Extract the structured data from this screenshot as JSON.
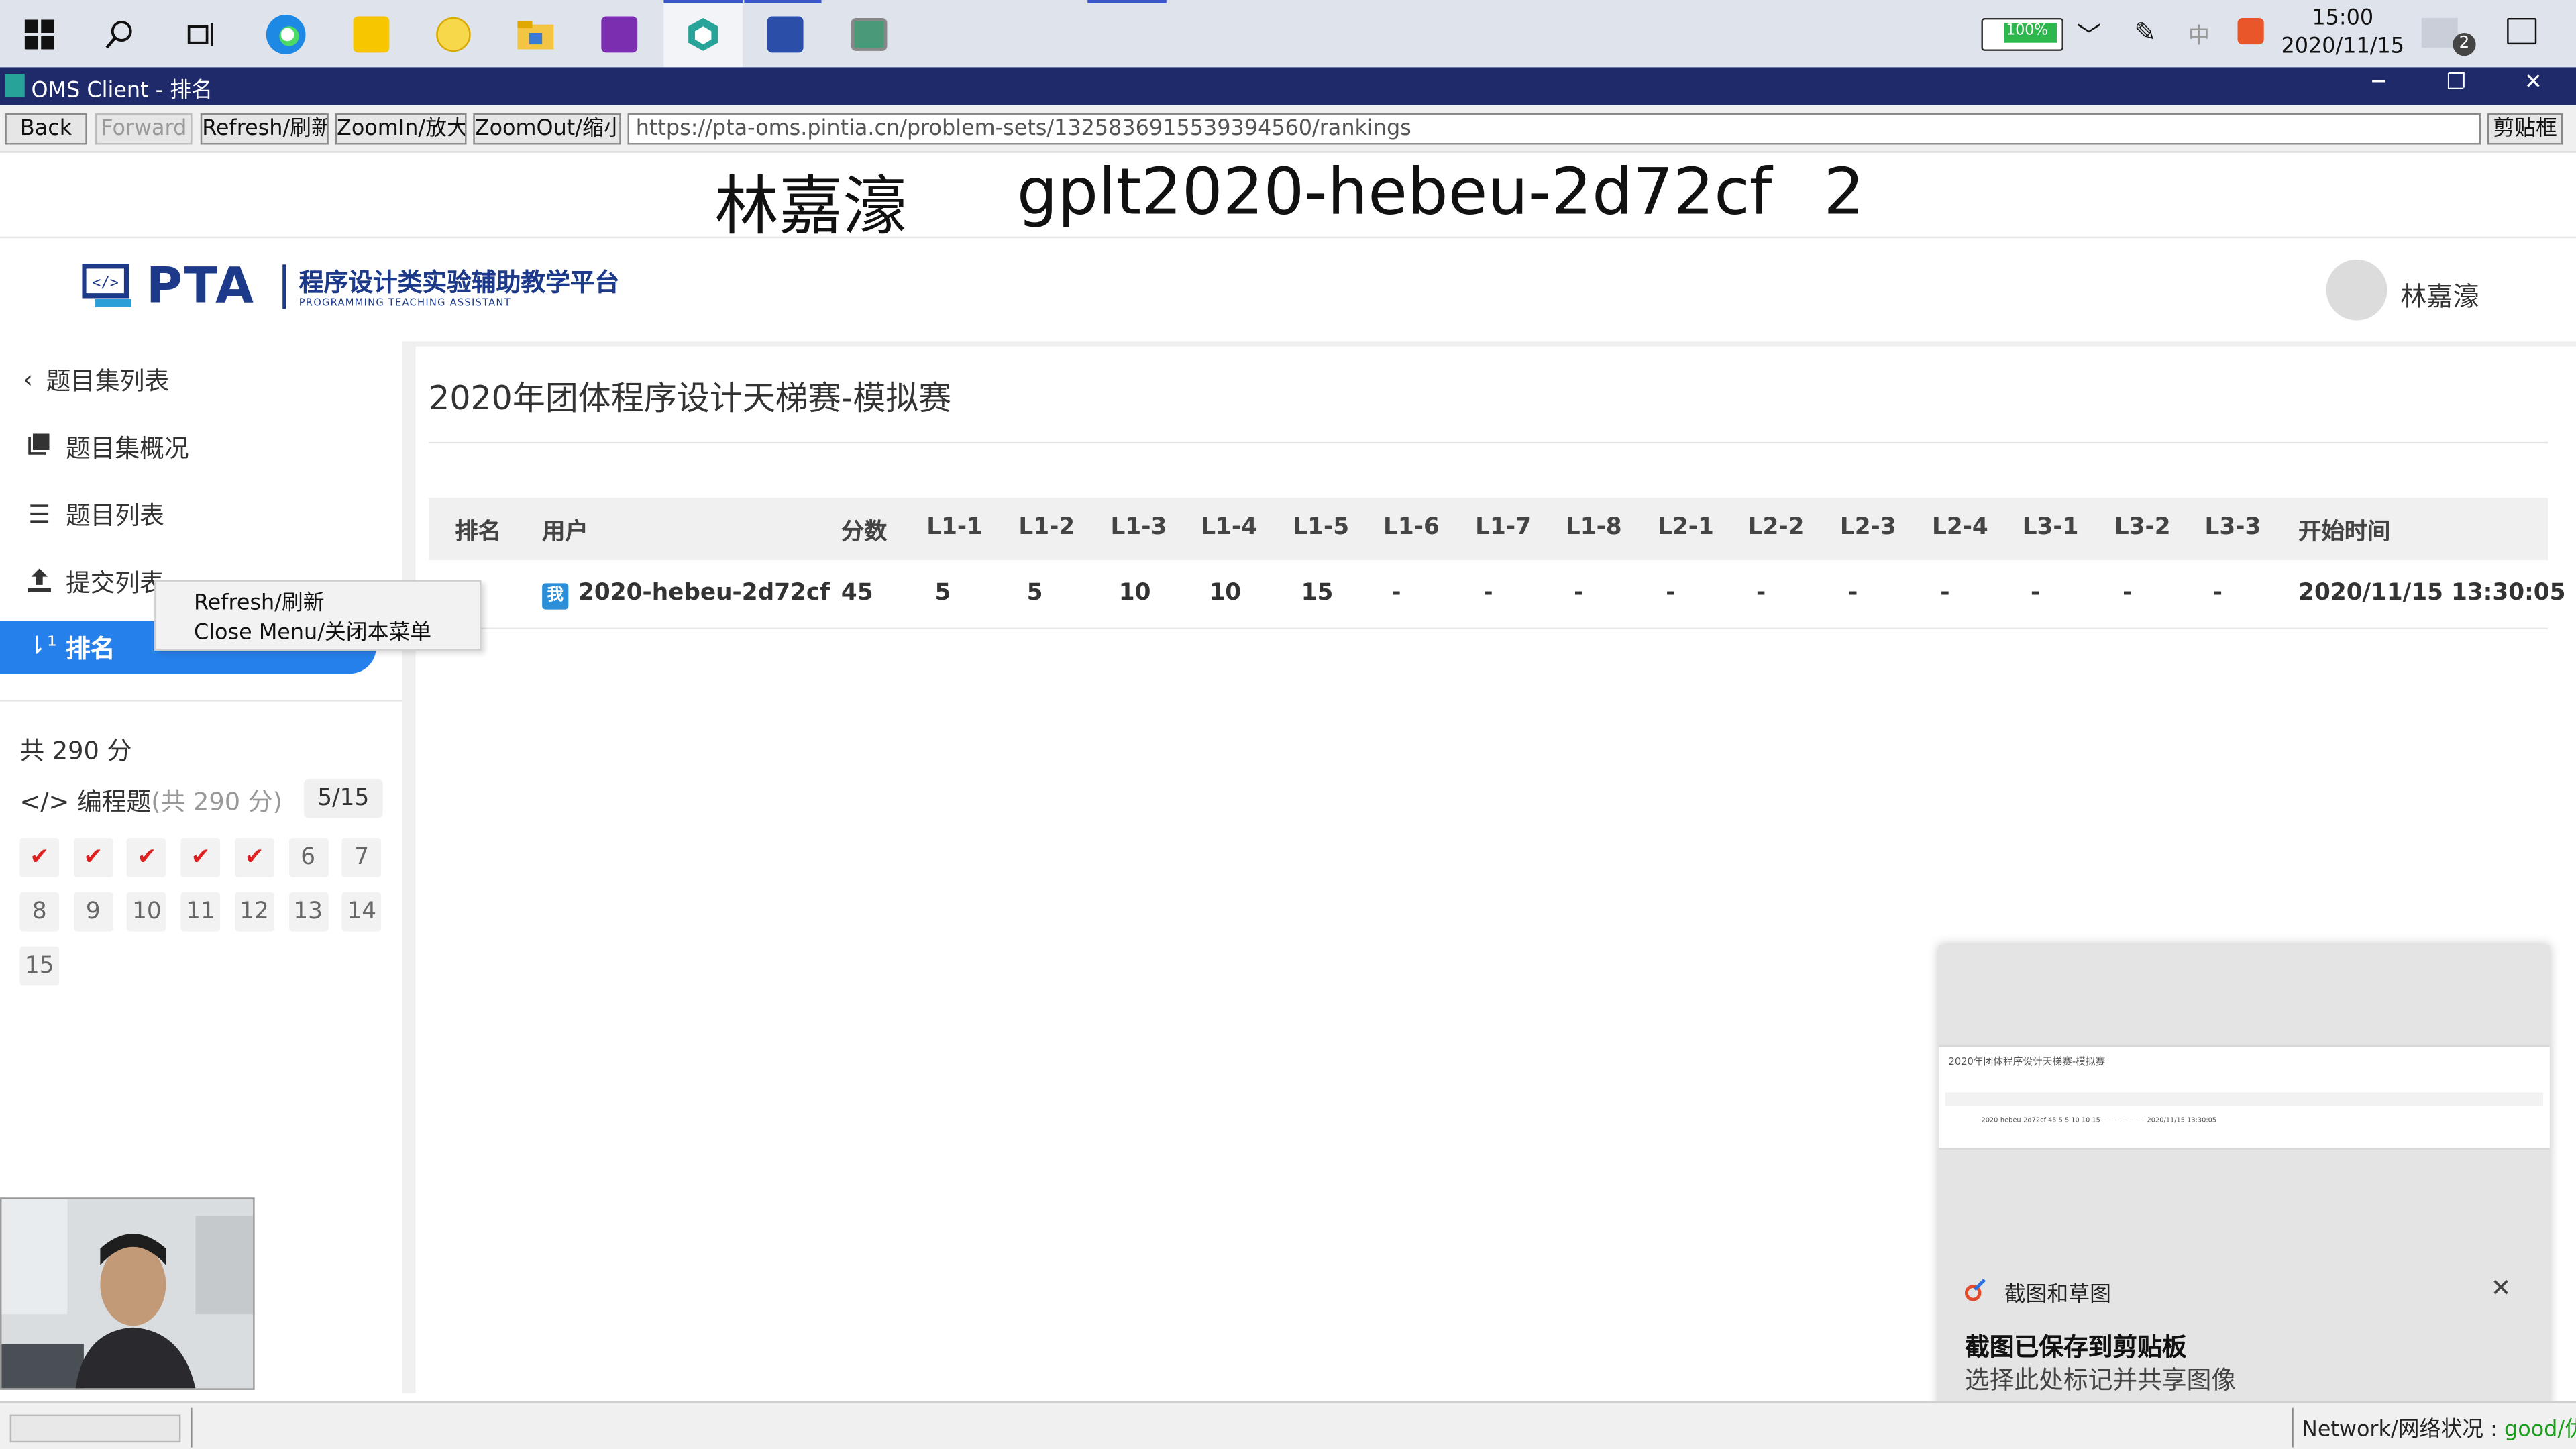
{
  "taskbar": {
    "battery": "100%",
    "ime": "中",
    "time": "15:00",
    "date": "2020/11/15",
    "badge": "2"
  },
  "window": {
    "title": "OMS Client - 排名",
    "minimize": "─",
    "restore": "❐",
    "close": "✕"
  },
  "toolbar": {
    "back": "Back",
    "forward": "Forward",
    "refresh": "Refresh/刷新",
    "zoomin": "ZoomIn/放大",
    "zoomout": "ZoomOut/缩小",
    "url": "https://pta-oms.pintia.cn/problem-sets/1325836915539394560/rankings",
    "clipboard": "剪贴框"
  },
  "overlay": {
    "name": "林嘉濠",
    "account": "gplt2020-hebeu-2d72cf",
    "number": "2"
  },
  "header": {
    "logo_text": "PTA",
    "logo_cn": "程序设计类实验辅助教学平台",
    "logo_en": "PROGRAMMING TEACHING ASSISTANT",
    "user": "林嘉濠"
  },
  "sidebar": {
    "back_label": "题目集列表",
    "items": [
      {
        "label": "题目集概况"
      },
      {
        "label": "题目列表"
      },
      {
        "label": "提交列表"
      },
      {
        "label": "排名"
      }
    ],
    "total": "共 290 分",
    "section_label": "编程题",
    "section_total": "(共 290 分)",
    "section_progress": "5/15",
    "questions": [
      {
        "label": "✔",
        "state": "accepted"
      },
      {
        "label": "✔",
        "state": "accepted"
      },
      {
        "label": "✔",
        "state": "accepted"
      },
      {
        "label": "✔",
        "state": "accepted"
      },
      {
        "label": "✔",
        "state": "accepted"
      },
      {
        "label": "6",
        "state": "none"
      },
      {
        "label": "7",
        "state": "none"
      },
      {
        "label": "8",
        "state": "none"
      },
      {
        "label": "9",
        "state": "none"
      },
      {
        "label": "10",
        "state": "none"
      },
      {
        "label": "11",
        "state": "none"
      },
      {
        "label": "12",
        "state": "none"
      },
      {
        "label": "13",
        "state": "none"
      },
      {
        "label": "14",
        "state": "none"
      },
      {
        "label": "15",
        "state": "none"
      }
    ]
  },
  "context_menu": {
    "items": [
      "Refresh/刷新",
      "Close Menu/关闭本菜单"
    ]
  },
  "main": {
    "title": "2020年团体程序设计天梯赛-模拟赛",
    "table": {
      "headers": [
        "排名",
        "用户",
        "分数",
        "L1-1",
        "L1-2",
        "L1-3",
        "L1-4",
        "L1-5",
        "L1-6",
        "L1-7",
        "L1-8",
        "L2-1",
        "L2-2",
        "L2-3",
        "L2-4",
        "L3-1",
        "L3-2",
        "L3-3",
        "开始时间"
      ],
      "row": {
        "me_badge": "我",
        "user": "2020-hebeu-2d72cf",
        "score": "45",
        "cells": [
          "5",
          "5",
          "10",
          "10",
          "15",
          "-",
          "-",
          "-",
          "-",
          "-",
          "-",
          "-",
          "-",
          "-",
          "-"
        ],
        "start_time": "2020/11/15 13:30:05"
      }
    }
  },
  "notification": {
    "app": "截图和草图",
    "close": "✕",
    "title": "截图已保存到剪贴板",
    "subtitle": "选择此处标记并共享图像",
    "thumb_title": "2020年团体程序设计天梯赛-模拟赛",
    "thumb_row": "2020-hebeu-2d72cf  45  5  5  10  10  15  -  -  -  -  -  -  -  -  -  -  2020/11/15 13:30:05"
  },
  "statusbar": {
    "network_label": "Network/网络状况 : ",
    "network_value": "good/优"
  }
}
